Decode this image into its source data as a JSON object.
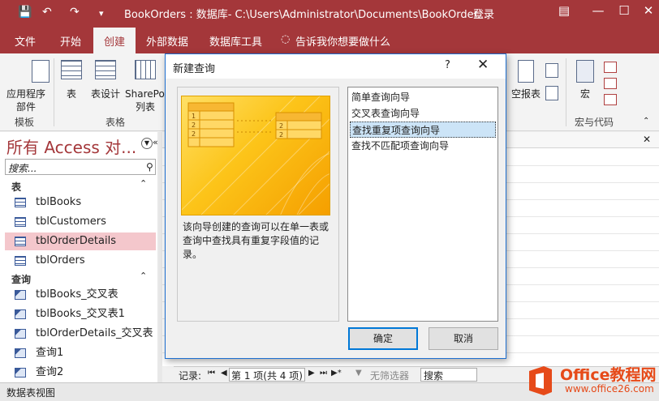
{
  "titlebar": {
    "title": "BookOrders : 数据库- C:\\Users\\Administrator\\Documents\\BookOrder...",
    "login": "登录"
  },
  "menu": [
    "文件",
    "开始",
    "创建",
    "外部数据",
    "数据库工具"
  ],
  "tellme": "告诉我你想要做什么",
  "ribbon": {
    "app_parts": "应用程序",
    "app_parts2": "部件",
    "table": "表",
    "table_design": "表设计",
    "sharepoint": "SharePoi",
    "sharepoint2": "列表",
    "blank_report": "空报表",
    "macro": "宏",
    "group_templates": "模板",
    "group_tables": "表格",
    "group_macros": "宏与代码"
  },
  "nav": {
    "title": "所有 Access 对...",
    "search_placeholder": "搜索...",
    "section_tables": "表",
    "tables": [
      "tblBooks",
      "tblCustomers",
      "tblOrderDetails",
      "tblOrders"
    ],
    "section_queries": "查询",
    "queries": [
      "tblBooks_交叉表",
      "tblBooks_交叉表1",
      "tblOrderDetails_交叉表",
      "查询1",
      "查询2"
    ]
  },
  "dialog": {
    "title": "新建查询",
    "help": "?",
    "description": "该向导创建的查询可以在单一表或查询中查找具有重复字段值的记录。",
    "options": [
      "简单查询向导",
      "交叉表查询向导",
      "查找重复项查询向导",
      "查找不匹配项查询向导"
    ],
    "selected_index": 2,
    "ok": "确定",
    "cancel": "取消"
  },
  "recbar": {
    "record_label": "记录:",
    "position": "第 1 项(共 4 项)",
    "filter": "无筛选器",
    "search": "搜索"
  },
  "status": "数据表视图",
  "watermark": {
    "brand": "Office教程网",
    "url": "www.office26.com"
  },
  "colors": {
    "accent": "#a4373a",
    "selection": "#f4c7cc",
    "dialog_border": "#1e6fd0"
  }
}
